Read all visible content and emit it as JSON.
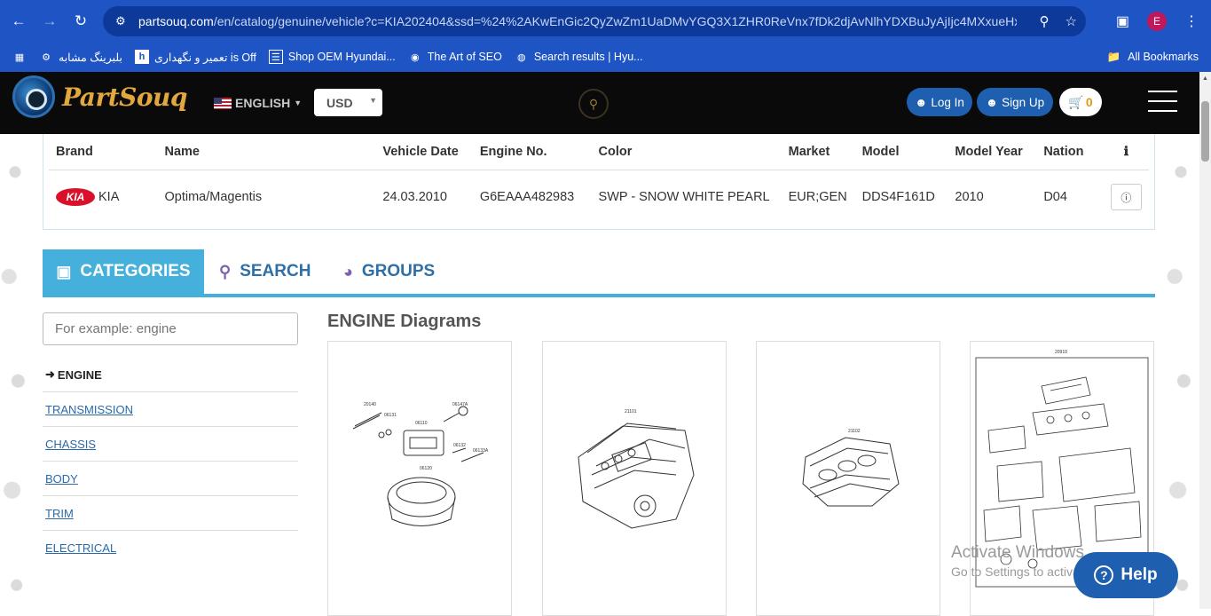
{
  "browser": {
    "url_host": "partsouq.com",
    "url_path": "/en/catalog/genuine/vehicle?c=KIA202404&ssd=%24%2AKwEnGic2QyZwZm1UaDMvYGQ3X1ZHR0ReVnx7fDk2djAvNlhYDXBuJyAjIjc4MXxueHxR...",
    "profile_initial": "E",
    "bookmarks": [
      {
        "label": "بلبرینگ مشابه"
      },
      {
        "label": "تعمیر و نگهداری is Off"
      },
      {
        "label": "Shop OEM Hyundai..."
      },
      {
        "label": "The Art of SEO"
      },
      {
        "label": "Search results | Hyu..."
      }
    ],
    "all_bookmarks": "All Bookmarks"
  },
  "header": {
    "logo_text": "PartSouq",
    "language": "ENGLISH",
    "currency": "USD",
    "login": "Log In",
    "signup": "Sign Up",
    "cart_count": "0"
  },
  "vehicle": {
    "columns": [
      "Brand",
      "Name",
      "Vehicle Date",
      "Engine No.",
      "Color",
      "Market",
      "Model",
      "Model Year",
      "Nation"
    ],
    "row": {
      "brand": "KIA",
      "brand_logo": "KIA",
      "name": "Optima/Magentis",
      "date": "24.03.2010",
      "engine": "G6EAAA482983",
      "color": "SWP - SNOW WHITE PEARL",
      "market": "EUR;GEN",
      "model": "DDS4F161D",
      "year": "2010",
      "nation": "D04"
    }
  },
  "tabs": {
    "categories": "CATEGORIES",
    "search": "SEARCH",
    "groups": "GROUPS"
  },
  "sidebar": {
    "placeholder": "For example: engine",
    "categories": [
      "ENGINE",
      "TRANSMISSION",
      "CHASSIS",
      "BODY",
      "TRIM",
      "ELECTRICAL"
    ]
  },
  "diagrams": {
    "title": "ENGINE Diagrams",
    "cards": [
      {
        "labels": [
          "20140",
          "06131",
          "06110",
          "06147A",
          "06132",
          "06133A",
          "06120"
        ]
      },
      {
        "labels": [
          "21101"
        ]
      },
      {
        "labels": [
          "21102"
        ]
      },
      {
        "labels": [
          "20910"
        ]
      }
    ]
  },
  "overlay": {
    "watermark_title": "Activate Windows",
    "watermark_sub": "Go to Settings to activate Windows.",
    "help": "Help"
  },
  "colors": {
    "chrome_blue": "#1e54c4",
    "tab_active": "#46b0dc",
    "button_blue": "#1e5fb0",
    "logo_gold": "#e2a83d"
  }
}
